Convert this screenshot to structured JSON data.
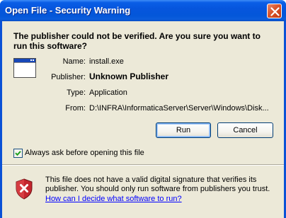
{
  "window": {
    "title": "Open File - Security Warning"
  },
  "main": {
    "heading": "The publisher could not be verified.  Are you sure you want to run this software?",
    "fields": [
      {
        "label": "Name:",
        "value": "install.exe"
      },
      {
        "label": "Publisher:",
        "value": "Unknown Publisher"
      },
      {
        "label": "Type:",
        "value": "Application"
      },
      {
        "label": "From:",
        "value": "D:\\INFRA\\InformaticaServer\\Server\\Windows\\Disk..."
      }
    ]
  },
  "buttons": {
    "run_label": "Run",
    "cancel_label": "Cancel"
  },
  "checkbox": {
    "label": "Always ask before opening this file",
    "checked": true
  },
  "warning": {
    "text": "This file does not have a valid digital signature that verifies its publisher.  You should only run software from publishers you trust.",
    "link": "How can I decide what software to run?"
  },
  "icons": {
    "close": "close-icon",
    "app": "application-window-icon",
    "shield": "security-shield-icon",
    "check": "checkmark-icon"
  },
  "colors": {
    "titlebar": "#0a5ee6",
    "face": "#ece9d8",
    "close": "#d9542b",
    "link": "#0000ff",
    "shield": "#c4262e"
  }
}
